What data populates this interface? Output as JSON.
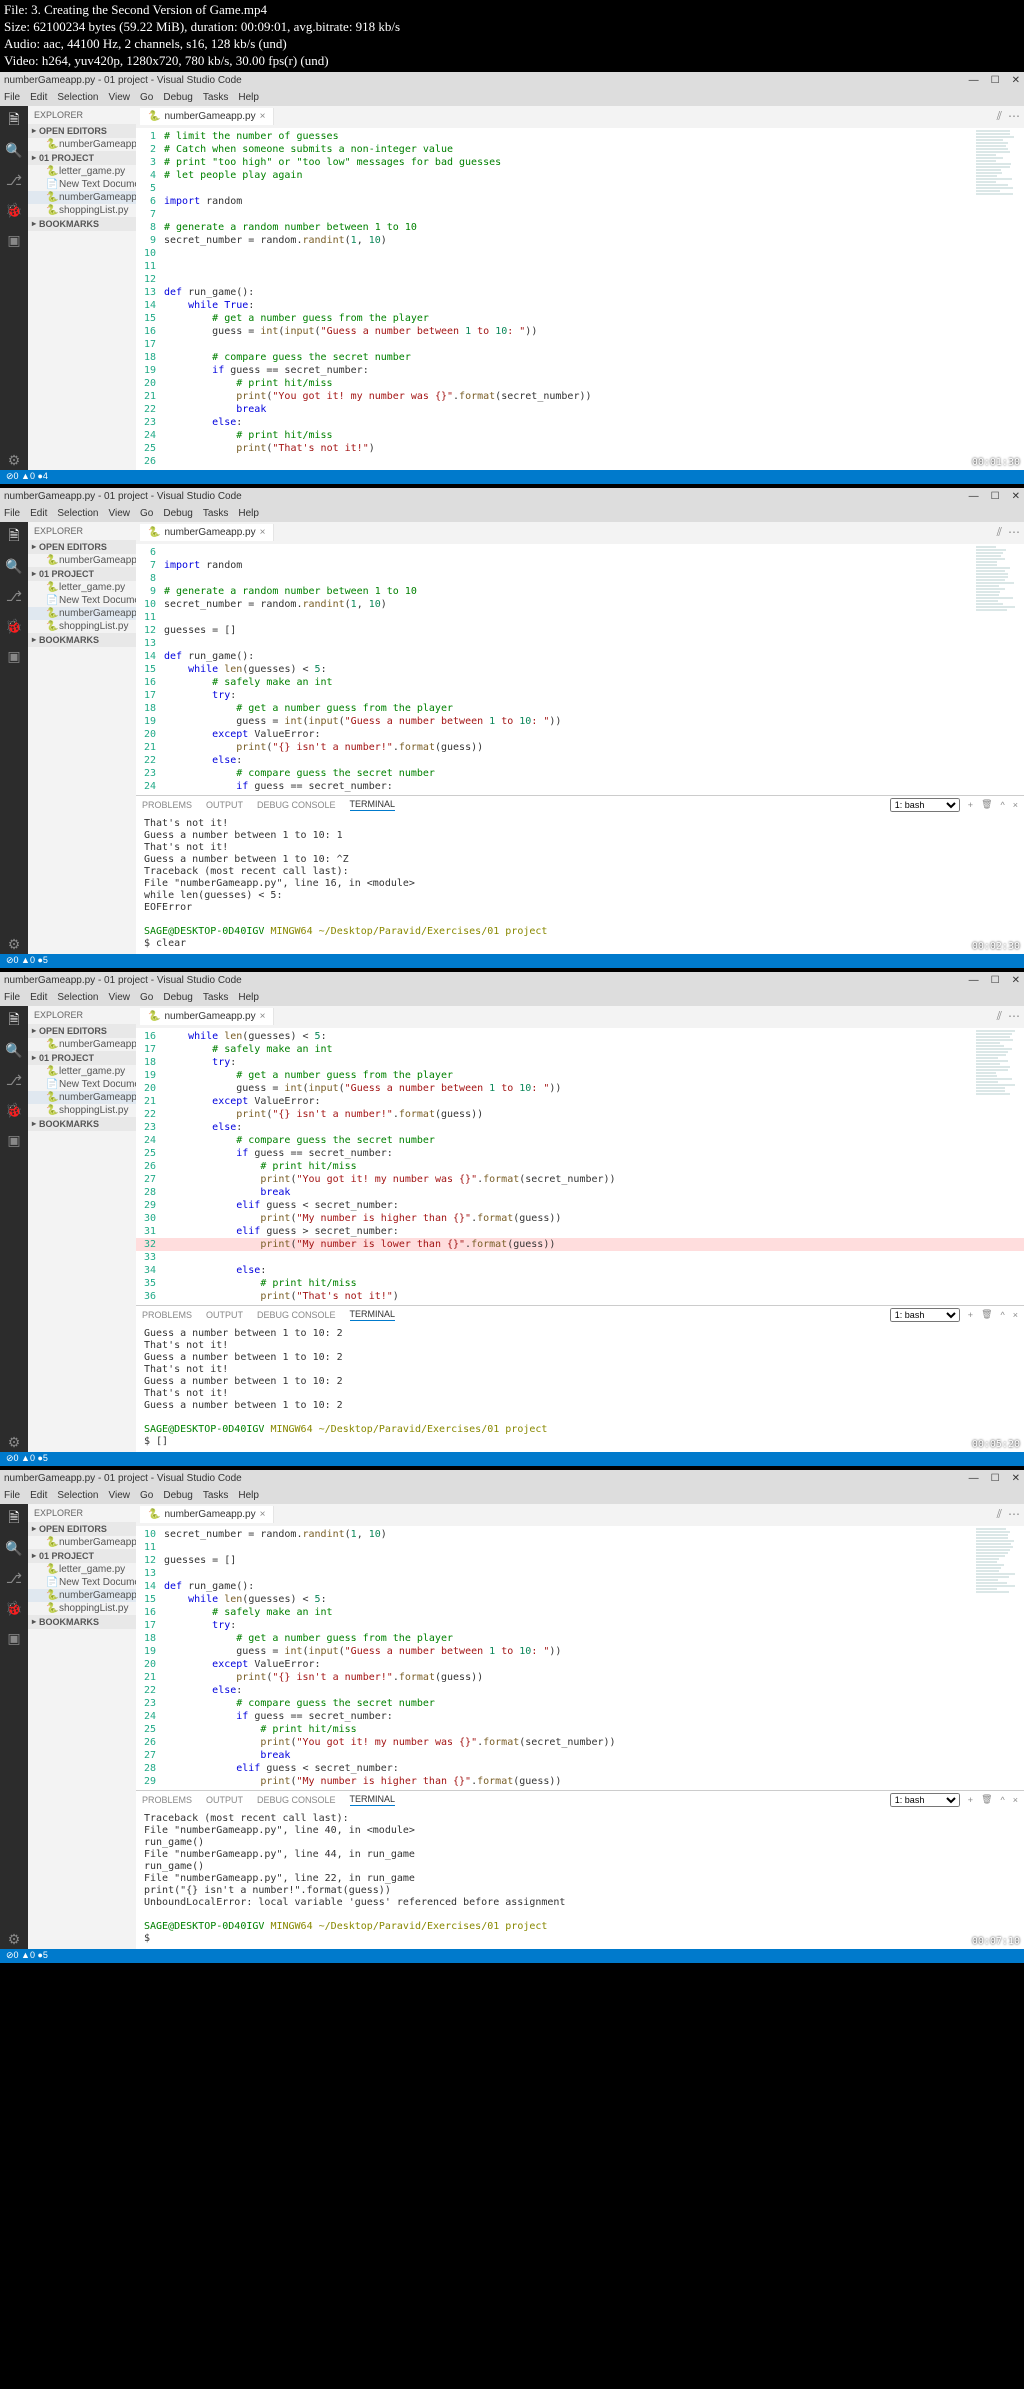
{
  "info": {
    "line1": "File: 3. Creating the Second Version of Game.mp4",
    "line2": "Size: 62100234 bytes (59.22 MiB), duration: 00:09:01, avg.bitrate: 918 kb/s",
    "line3": "Audio: aac, 44100 Hz, 2 channels, s16, 128 kb/s (und)",
    "line4": "Video: h264, yuv420p, 1280x720, 780 kb/s, 30.00 fps(r) (und)"
  },
  "common": {
    "title_suffix": " - 01 project - Visual Studio Code",
    "file_tab": "numberGameapp.py",
    "menu": [
      "File",
      "Edit",
      "Selection",
      "View",
      "Go",
      "Debug",
      "Tasks",
      "Help"
    ],
    "sidebar_header": "EXPLORER",
    "open_editors": "OPEN EDITORS",
    "project": "01 PROJECT",
    "files": [
      "letter_game.py",
      "New Text Document.txt",
      "numberGameapp.py",
      "shoppingList.py"
    ],
    "bookmarks": "BOOKMARKS",
    "panel_tabs": [
      "PROBLEMS",
      "OUTPUT",
      "DEBUG CONSOLE",
      "TERMINAL"
    ],
    "terminal_dropdown": "1: bash",
    "prompt_user": "SAGE@DESKTOP-0D40IGV",
    "prompt_shell": "MINGW64",
    "prompt_path": "~/Desktop/Paravid/Exercises/01 project"
  },
  "win1": {
    "status": "⊘0 ▲0 ●4",
    "timestamp": "00:01:30",
    "code": [
      {
        "n": 1,
        "t": "com",
        "v": "# limit the number of guesses"
      },
      {
        "n": 2,
        "t": "com",
        "v": "# Catch when someone submits a non-integer value"
      },
      {
        "n": 3,
        "t": "com",
        "v": "# print \"too high\" or \"too low\" messages for bad guesses"
      },
      {
        "n": 4,
        "t": "com",
        "v": "# let people play again"
      },
      {
        "n": 5,
        "t": "",
        "v": ""
      },
      {
        "n": 6,
        "t": "",
        "v": "import random"
      },
      {
        "n": 7,
        "t": "",
        "v": ""
      },
      {
        "n": 8,
        "t": "com",
        "v": "# generate a random number between 1 to 10"
      },
      {
        "n": 9,
        "t": "",
        "v": "secret_number = random.randint(1, 10)"
      },
      {
        "n": 10,
        "t": "",
        "v": ""
      },
      {
        "n": 11,
        "t": "",
        "v": ""
      },
      {
        "n": 12,
        "t": "",
        "v": ""
      },
      {
        "n": 13,
        "t": "",
        "v": "def run_game():"
      },
      {
        "n": 14,
        "t": "",
        "v": "    while True:"
      },
      {
        "n": 15,
        "t": "com",
        "v": "        # get a number guess from the player"
      },
      {
        "n": 16,
        "t": "",
        "v": "        guess = int(input(\"Guess a number between 1 to 10: \"))"
      },
      {
        "n": 17,
        "t": "",
        "v": ""
      },
      {
        "n": 18,
        "t": "com",
        "v": "        # compare guess the secret number"
      },
      {
        "n": 19,
        "t": "",
        "v": "        if guess == secret_number:"
      },
      {
        "n": 20,
        "t": "com",
        "v": "            # print hit/miss"
      },
      {
        "n": 21,
        "t": "",
        "v": "            print(\"You got it! my number was {}\".format(secret_number))"
      },
      {
        "n": 22,
        "t": "",
        "v": "            break"
      },
      {
        "n": 23,
        "t": "",
        "v": "        else:"
      },
      {
        "n": 24,
        "t": "com",
        "v": "            # print hit/miss"
      },
      {
        "n": 25,
        "t": "",
        "v": "            print(\"That's not it!\")"
      },
      {
        "n": 26,
        "t": "",
        "v": ""
      }
    ]
  },
  "win2": {
    "status": "⊘0 ▲0 ●5",
    "timestamp": "00:02:30",
    "code": [
      {
        "n": 6,
        "t": "",
        "v": ""
      },
      {
        "n": 7,
        "t": "",
        "v": "import random"
      },
      {
        "n": 8,
        "t": "",
        "v": ""
      },
      {
        "n": 9,
        "t": "com",
        "v": "# generate a random number between 1 to 10"
      },
      {
        "n": 10,
        "t": "",
        "v": "secret_number = random.randint(1, 10)"
      },
      {
        "n": 11,
        "t": "",
        "v": ""
      },
      {
        "n": 12,
        "t": "",
        "v": "guesses = []"
      },
      {
        "n": 13,
        "t": "",
        "v": ""
      },
      {
        "n": 14,
        "t": "",
        "v": "def run_game():"
      },
      {
        "n": 15,
        "t": "",
        "v": "    while len(guesses) < 5:"
      },
      {
        "n": 16,
        "t": "com",
        "v": "        # safely make an int"
      },
      {
        "n": 17,
        "t": "",
        "v": "        try:"
      },
      {
        "n": 18,
        "t": "com",
        "v": "            # get a number guess from the player"
      },
      {
        "n": 19,
        "t": "",
        "v": "            guess = int(input(\"Guess a number between 1 to 10: \"))"
      },
      {
        "n": 20,
        "t": "",
        "v": "        except ValueError:"
      },
      {
        "n": 21,
        "t": "",
        "v": "            print(\"{} isn't a number!\".format(guess))"
      },
      {
        "n": 22,
        "t": "",
        "v": "        else:"
      },
      {
        "n": 23,
        "t": "com",
        "v": "            # compare guess the secret number"
      },
      {
        "n": 24,
        "t": "",
        "v": "            if guess == secret_number:"
      }
    ],
    "terminal": [
      "That's not it!",
      "Guess a number between 1 to 10: 1",
      "That's not it!",
      "Guess a number between 1 to 10: ^Z",
      "Traceback (most recent call last):",
      "  File \"numberGameapp.py\", line 16, in <module>",
      "    while len(guesses) < 5:",
      "EOFError",
      "",
      "$ clear"
    ]
  },
  "win3": {
    "status": "⊘0 ▲0 ●5",
    "timestamp": "00:05:20",
    "code": [
      {
        "n": 16,
        "t": "",
        "v": "    while len(guesses) < 5:"
      },
      {
        "n": 17,
        "t": "com",
        "v": "        # safely make an int"
      },
      {
        "n": 18,
        "t": "",
        "v": "        try:"
      },
      {
        "n": 19,
        "t": "com",
        "v": "            # get a number guess from the player"
      },
      {
        "n": 20,
        "t": "",
        "v": "            guess = int(input(\"Guess a number between 1 to 10: \"))"
      },
      {
        "n": 21,
        "t": "",
        "v": "        except ValueError:"
      },
      {
        "n": 22,
        "t": "",
        "v": "            print(\"{} isn't a number!\".format(guess))"
      },
      {
        "n": 23,
        "t": "",
        "v": "        else:"
      },
      {
        "n": 24,
        "t": "com",
        "v": "            # compare guess the secret number"
      },
      {
        "n": 25,
        "t": "",
        "v": "            if guess == secret_number:"
      },
      {
        "n": 26,
        "t": "com",
        "v": "                # print hit/miss"
      },
      {
        "n": 27,
        "t": "",
        "v": "                print(\"You got it! my number was {}\".format(secret_number))"
      },
      {
        "n": 28,
        "t": "",
        "v": "                break"
      },
      {
        "n": 29,
        "t": "",
        "v": "            elif guess < secret_number:"
      },
      {
        "n": 30,
        "t": "",
        "v": "                print(\"My number is higher than {}\".format(guess))"
      },
      {
        "n": 31,
        "t": "",
        "v": "            elif guess > secret_number:"
      },
      {
        "n": 32,
        "t": "err",
        "v": "                print(\"My number is lower than {}\".format(guess))"
      },
      {
        "n": 33,
        "t": "",
        "v": ""
      },
      {
        "n": 34,
        "t": "",
        "v": "            else:"
      },
      {
        "n": 35,
        "t": "com",
        "v": "                # print hit/miss"
      },
      {
        "n": 36,
        "t": "",
        "v": "                print(\"That's not it!\")"
      }
    ],
    "terminal": [
      "Guess a number between 1 to 10: 2",
      "That's not it!",
      "Guess a number between 1 to 10: 2",
      "That's not it!",
      "Guess a number between 1 to 10: 2",
      "That's not it!",
      "Guess a number between 1 to 10: 2",
      "",
      "$ []"
    ]
  },
  "win4": {
    "status": "⊘0 ▲0 ●5",
    "timestamp": "00:07:10",
    "code": [
      {
        "n": 10,
        "t": "",
        "v": "secret_number = random.randint(1, 10)"
      },
      {
        "n": 11,
        "t": "",
        "v": ""
      },
      {
        "n": 12,
        "t": "",
        "v": "guesses = []"
      },
      {
        "n": 13,
        "t": "",
        "v": ""
      },
      {
        "n": 14,
        "t": "",
        "v": "def run_game():"
      },
      {
        "n": 15,
        "t": "",
        "v": "    while len(guesses) < 5:"
      },
      {
        "n": 16,
        "t": "com",
        "v": "        # safely make an int"
      },
      {
        "n": 17,
        "t": "",
        "v": "        try:"
      },
      {
        "n": 18,
        "t": "com",
        "v": "            # get a number guess from the player"
      },
      {
        "n": 19,
        "t": "",
        "v": "            guess = int(input(\"Guess a number between 1 to 10: \"))"
      },
      {
        "n": 20,
        "t": "",
        "v": "        except ValueError:"
      },
      {
        "n": 21,
        "t": "",
        "v": "            print(\"{} isn't a number!\".format(guess))"
      },
      {
        "n": 22,
        "t": "",
        "v": "        else:"
      },
      {
        "n": 23,
        "t": "com",
        "v": "            # compare guess the secret number"
      },
      {
        "n": 24,
        "t": "",
        "v": "            if guess == secret_number:"
      },
      {
        "n": 25,
        "t": "com",
        "v": "                # print hit/miss"
      },
      {
        "n": 26,
        "t": "",
        "v": "                print(\"You got it! my number was {}\".format(secret_number))"
      },
      {
        "n": 27,
        "t": "",
        "v": "                break"
      },
      {
        "n": 28,
        "t": "",
        "v": "            elif guess < secret_number:"
      },
      {
        "n": 29,
        "t": "",
        "v": "                print(\"My number is higher than {}\".format(guess))"
      }
    ],
    "terminal": [
      "Traceback (most recent call last):",
      "  File \"numberGameapp.py\", line 40, in <module>",
      "    run_game()",
      "  File \"numberGameapp.py\", line 44, in run_game",
      "    run_game()",
      "  File \"numberGameapp.py\", line 22, in run_game",
      "    print(\"{} isn't a number!\".format(guess))",
      "UnboundLocalError: local variable 'guess' referenced before assignment",
      "",
      "$ "
    ]
  }
}
